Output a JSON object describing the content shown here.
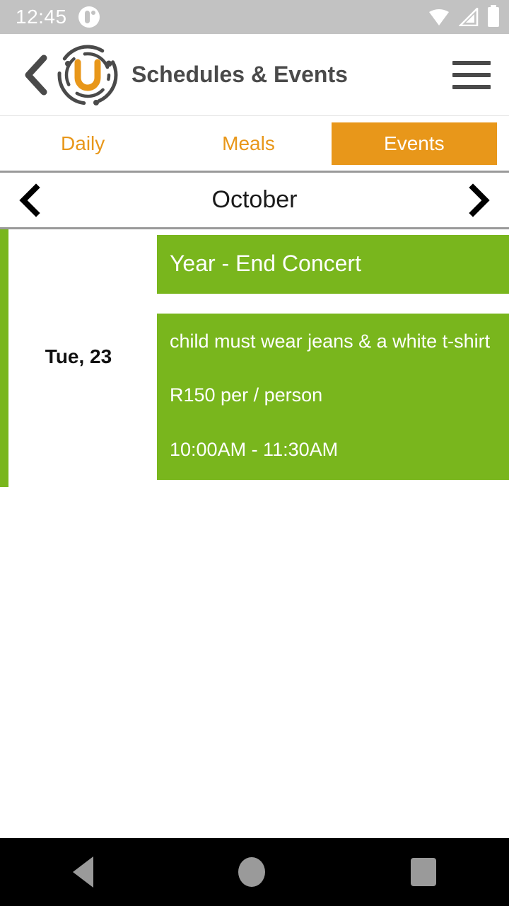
{
  "statusbar": {
    "time": "12:45",
    "notification_icon": "notification-dot-icon",
    "wifi_icon": "wifi-icon",
    "cellular_icon": "cellular-signal-icon",
    "battery_icon": "battery-full-icon"
  },
  "appbar": {
    "back_icon": "back-chevron-icon",
    "logo_icon": "app-logo-icon",
    "title": "Schedules & Events",
    "menu_icon": "hamburger-menu-icon"
  },
  "tabs": [
    {
      "label": "Daily",
      "active": false
    },
    {
      "label": "Meals",
      "active": false
    },
    {
      "label": "Events",
      "active": true
    }
  ],
  "month_nav": {
    "prev_icon": "chevron-left-icon",
    "label": "October",
    "next_icon": "chevron-right-icon"
  },
  "events": [
    {
      "date": "Tue, 23",
      "title": "Year - End Concert",
      "description": "child must wear jeans & a white t-shirt",
      "price": "R150 per / person",
      "time": "10:00AM   - 11:30AM"
    }
  ],
  "navbar": {
    "back_icon": "nav-back-icon",
    "home_icon": "nav-home-icon",
    "recents_icon": "nav-recents-icon"
  },
  "colors": {
    "accent_orange": "#e8971a",
    "event_green": "#79b61d",
    "statusbar_gray": "#c2c2c2",
    "title_gray": "#4a4a4a"
  }
}
